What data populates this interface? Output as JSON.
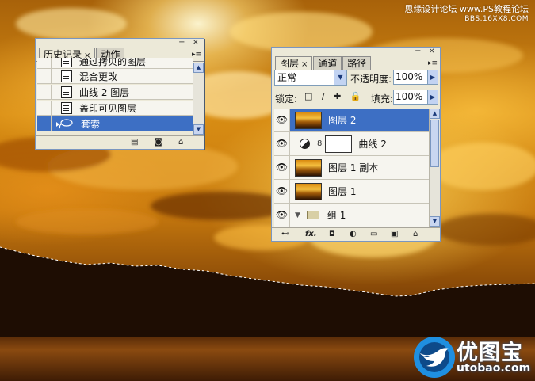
{
  "watermark": {
    "line1": "思缘设计论坛 www.PS教程论坛",
    "line2": "BBS.16XX8.COM"
  },
  "history_panel": {
    "tabs": [
      {
        "label": "历史记录",
        "close": "×"
      },
      {
        "label": "动作"
      }
    ],
    "titlebar_buttons": "− ×",
    "menu_icon": "▸≡",
    "items": [
      {
        "label": "通过拷贝的图层",
        "icon": "history-state-icon"
      },
      {
        "label": "混合更改",
        "icon": "history-state-icon"
      },
      {
        "label": "曲线 2 图层",
        "icon": "history-state-icon"
      },
      {
        "label": "盖印可见图层",
        "icon": "history-state-icon"
      },
      {
        "label": "套索",
        "icon": "lasso-icon",
        "selected": true
      }
    ]
  },
  "layers_panel": {
    "tabs": [
      {
        "label": "图层",
        "close": "×"
      },
      {
        "label": "通道"
      },
      {
        "label": "路径"
      }
    ],
    "titlebar_buttons": "− ×",
    "menu_icon": "▸≡",
    "blend_mode": "正常",
    "opacity_label": "不透明度:",
    "opacity_value": "100%",
    "lock_label": "锁定:",
    "lock_icons": "□ ∕ ✚ 🔒",
    "fill_label": "填充:",
    "fill_value": "100%",
    "layers": [
      {
        "name": "图层 2",
        "type": "pixel",
        "selected": true
      },
      {
        "name": "曲线 2",
        "type": "adjustment"
      },
      {
        "name": "图层 1 副本",
        "type": "pixel"
      },
      {
        "name": "图层 1",
        "type": "pixel"
      },
      {
        "name": "组 1",
        "type": "group"
      }
    ],
    "footer_icons": [
      "link-icon",
      "fx-icon",
      "mask-icon",
      "adjustment-icon",
      "folder-icon",
      "new-layer-icon",
      "trash-icon"
    ],
    "fx_label": "fx."
  },
  "logo": {
    "zh": "优图宝",
    "en": "utobao.com"
  },
  "colors": {
    "selection": "#3d6fc4",
    "panel_bg": "#ece9d8",
    "sky": "#d88d14"
  }
}
